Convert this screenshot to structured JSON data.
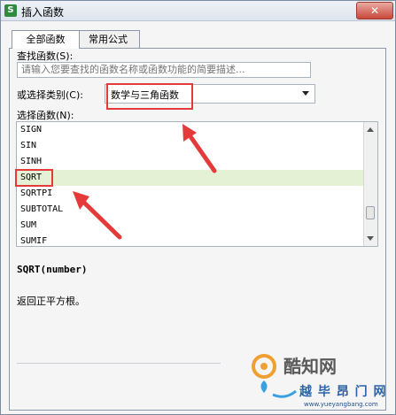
{
  "window": {
    "title": "插入函数",
    "app_icon": "S"
  },
  "tabs": [
    {
      "label": "全部函数",
      "active": true
    },
    {
      "label": "常用公式",
      "active": false
    }
  ],
  "search": {
    "label": "查找函数(S):",
    "placeholder": "请输入您要查找的函数名称或函数功能的简要描述..."
  },
  "category": {
    "label": "或选择类别(C):",
    "value": "数学与三角函数"
  },
  "function_list": {
    "label": "选择函数(N):",
    "items": [
      "SIGN",
      "SIN",
      "SINH",
      "SQRT",
      "SQRTPI",
      "SUBTOTAL",
      "SUM",
      "SUMIF"
    ],
    "selected": "SQRT"
  },
  "selected_function": {
    "signature": "SQRT(number)",
    "description": "返回正平方根。"
  },
  "watermark": {
    "text": "酷知网",
    "text2": "越 毕 昂 门 网",
    "url": "www.yueyangbang.com"
  },
  "colors": {
    "annotation": "#e43a3a",
    "selected_row": "#e4f1d4",
    "app_icon": "#2e8b3e"
  }
}
